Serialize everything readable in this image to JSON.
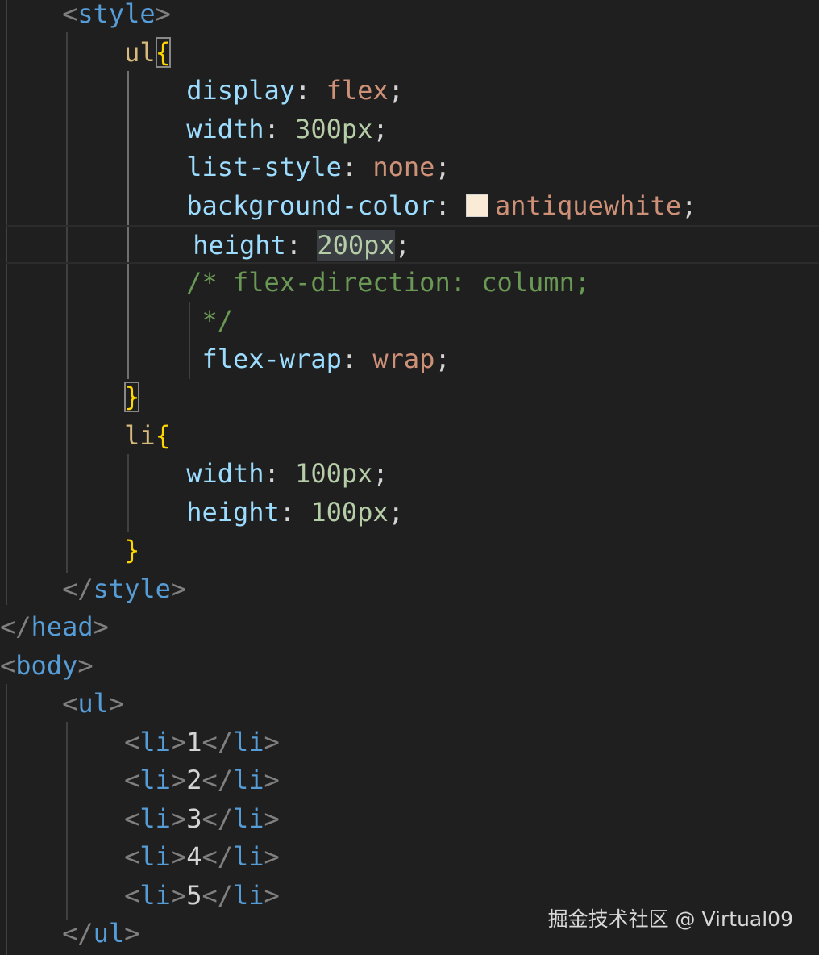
{
  "watermark": "掘金技术社区 @ Virtual09",
  "colors": {
    "background": "#1f1f1f",
    "tag": "#569cd6",
    "selector": "#d7ba7d",
    "brace": "#ffd700",
    "property": "#9cdcfe",
    "keyword": "#ce9178",
    "number": "#b5cea8",
    "comment": "#6a9955",
    "swatch": "#faebd7"
  },
  "lines": [
    [
      {
        "k": "ws",
        "t": "    "
      },
      {
        "k": "bracket",
        "t": "<"
      },
      {
        "k": "tag",
        "t": "style"
      },
      {
        "k": "bracket",
        "t": ">"
      }
    ],
    [
      {
        "k": "ws",
        "t": "        "
      },
      {
        "k": "sel",
        "t": "ul"
      },
      {
        "k": "brace-match",
        "t": "{"
      }
    ],
    [
      {
        "k": "ws",
        "t": "            "
      },
      {
        "k": "prop",
        "t": "display"
      },
      {
        "k": "text",
        "t": ": "
      },
      {
        "k": "kw",
        "t": "flex"
      },
      {
        "k": "text",
        "t": ";"
      }
    ],
    [
      {
        "k": "ws",
        "t": "            "
      },
      {
        "k": "prop",
        "t": "width"
      },
      {
        "k": "text",
        "t": ": "
      },
      {
        "k": "num",
        "t": "300px"
      },
      {
        "k": "text",
        "t": ";"
      }
    ],
    [
      {
        "k": "ws",
        "t": "            "
      },
      {
        "k": "prop",
        "t": "list-style"
      },
      {
        "k": "text",
        "t": ": "
      },
      {
        "k": "kw",
        "t": "none"
      },
      {
        "k": "text",
        "t": ";"
      }
    ],
    [
      {
        "k": "ws",
        "t": "            "
      },
      {
        "k": "prop",
        "t": "background-color"
      },
      {
        "k": "text",
        "t": ": "
      },
      {
        "k": "swatch",
        "t": ""
      },
      {
        "k": "kw",
        "t": "antiquewhite"
      },
      {
        "k": "text",
        "t": ";"
      }
    ],
    [
      {
        "k": "ws",
        "t": "            "
      },
      {
        "k": "prop",
        "t": "height"
      },
      {
        "k": "text",
        "t": ": "
      },
      {
        "k": "num-hl",
        "t": "200px"
      },
      {
        "k": "text",
        "t": ";"
      }
    ],
    [
      {
        "k": "ws",
        "t": "            "
      },
      {
        "k": "comment",
        "t": "/* flex-direction: column;"
      }
    ],
    [
      {
        "k": "ws",
        "t": "             "
      },
      {
        "k": "comment",
        "t": "*/"
      }
    ],
    [
      {
        "k": "ws",
        "t": "             "
      },
      {
        "k": "prop",
        "t": "flex-wrap"
      },
      {
        "k": "text",
        "t": ": "
      },
      {
        "k": "kw",
        "t": "wrap"
      },
      {
        "k": "text",
        "t": ";"
      }
    ],
    [
      {
        "k": "ws",
        "t": "        "
      },
      {
        "k": "brace-match",
        "t": "}"
      }
    ],
    [
      {
        "k": "ws",
        "t": "        "
      },
      {
        "k": "sel",
        "t": "li"
      },
      {
        "k": "brace",
        "t": "{"
      }
    ],
    [
      {
        "k": "ws",
        "t": "            "
      },
      {
        "k": "prop",
        "t": "width"
      },
      {
        "k": "text",
        "t": ": "
      },
      {
        "k": "num",
        "t": "100px"
      },
      {
        "k": "text",
        "t": ";"
      }
    ],
    [
      {
        "k": "ws",
        "t": "            "
      },
      {
        "k": "prop",
        "t": "height"
      },
      {
        "k": "text",
        "t": ": "
      },
      {
        "k": "num",
        "t": "100px"
      },
      {
        "k": "text",
        "t": ";"
      }
    ],
    [
      {
        "k": "ws",
        "t": "        "
      },
      {
        "k": "brace",
        "t": "}"
      }
    ],
    [
      {
        "k": "ws",
        "t": "    "
      },
      {
        "k": "bracket",
        "t": "</"
      },
      {
        "k": "tag",
        "t": "style"
      },
      {
        "k": "bracket",
        "t": ">"
      }
    ],
    [
      {
        "k": "bracket",
        "t": "</"
      },
      {
        "k": "tag",
        "t": "head"
      },
      {
        "k": "bracket",
        "t": ">"
      }
    ],
    [
      {
        "k": "bracket",
        "t": "<"
      },
      {
        "k": "tag",
        "t": "body"
      },
      {
        "k": "bracket",
        "t": ">"
      }
    ],
    [
      {
        "k": "ws",
        "t": "    "
      },
      {
        "k": "bracket",
        "t": "<"
      },
      {
        "k": "tag",
        "t": "ul"
      },
      {
        "k": "bracket",
        "t": ">"
      }
    ],
    [
      {
        "k": "ws",
        "t": "        "
      },
      {
        "k": "bracket",
        "t": "<"
      },
      {
        "k": "tag",
        "t": "li"
      },
      {
        "k": "bracket",
        "t": ">"
      },
      {
        "k": "text",
        "t": "1"
      },
      {
        "k": "bracket",
        "t": "</"
      },
      {
        "k": "tag",
        "t": "li"
      },
      {
        "k": "bracket",
        "t": ">"
      }
    ],
    [
      {
        "k": "ws",
        "t": "        "
      },
      {
        "k": "bracket",
        "t": "<"
      },
      {
        "k": "tag",
        "t": "li"
      },
      {
        "k": "bracket",
        "t": ">"
      },
      {
        "k": "text",
        "t": "2"
      },
      {
        "k": "bracket",
        "t": "</"
      },
      {
        "k": "tag",
        "t": "li"
      },
      {
        "k": "bracket",
        "t": ">"
      }
    ],
    [
      {
        "k": "ws",
        "t": "        "
      },
      {
        "k": "bracket",
        "t": "<"
      },
      {
        "k": "tag",
        "t": "li"
      },
      {
        "k": "bracket",
        "t": ">"
      },
      {
        "k": "text",
        "t": "3"
      },
      {
        "k": "bracket",
        "t": "</"
      },
      {
        "k": "tag",
        "t": "li"
      },
      {
        "k": "bracket",
        "t": ">"
      }
    ],
    [
      {
        "k": "ws",
        "t": "        "
      },
      {
        "k": "bracket",
        "t": "<"
      },
      {
        "k": "tag",
        "t": "li"
      },
      {
        "k": "bracket",
        "t": ">"
      },
      {
        "k": "text",
        "t": "4"
      },
      {
        "k": "bracket",
        "t": "</"
      },
      {
        "k": "tag",
        "t": "li"
      },
      {
        "k": "bracket",
        "t": ">"
      }
    ],
    [
      {
        "k": "ws",
        "t": "        "
      },
      {
        "k": "bracket",
        "t": "<"
      },
      {
        "k": "tag",
        "t": "li"
      },
      {
        "k": "bracket",
        "t": ">"
      },
      {
        "k": "text",
        "t": "5"
      },
      {
        "k": "bracket",
        "t": "</"
      },
      {
        "k": "tag",
        "t": "li"
      },
      {
        "k": "bracket",
        "t": ">"
      }
    ],
    [
      {
        "k": "ws",
        "t": "    "
      },
      {
        "k": "bracket",
        "t": "</"
      },
      {
        "k": "tag",
        "t": "ul"
      },
      {
        "k": "bracket",
        "t": ">"
      }
    ]
  ]
}
